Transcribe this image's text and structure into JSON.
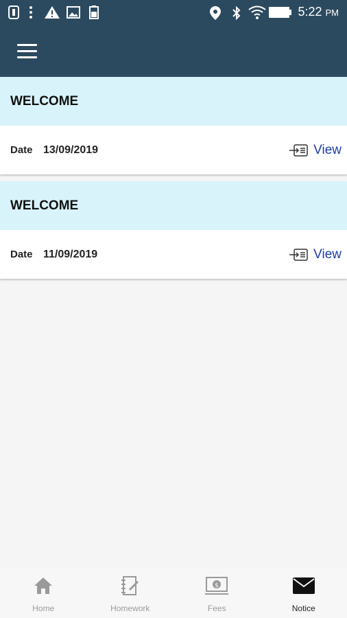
{
  "status_bar": {
    "time": "5:22",
    "ampm": "PM",
    "icons": [
      "sim-icon",
      "more-dots-icon",
      "warning-icon",
      "image-icon",
      "battery-saver-icon",
      "location-icon",
      "bluetooth-icon",
      "wifi-icon",
      "battery-icon"
    ]
  },
  "app_bar": {
    "menu_icon": "hamburger-menu-icon"
  },
  "notices": [
    {
      "title": "WELCOME",
      "date_label": "Date",
      "date": "13/09/2019",
      "view_label": "View"
    },
    {
      "title": "WELCOME",
      "date_label": "Date",
      "date": "11/09/2019",
      "view_label": "View"
    }
  ],
  "bottom_nav": {
    "items": [
      {
        "label": "Home",
        "icon": "home-icon",
        "active": false
      },
      {
        "label": "Homework",
        "icon": "homework-icon",
        "active": false
      },
      {
        "label": "Fees",
        "icon": "fees-icon",
        "active": false
      },
      {
        "label": "Notice",
        "icon": "mail-icon",
        "active": true
      }
    ]
  },
  "colors": {
    "app_bar": "#2c4a5f",
    "title_row": "#d8f3f9",
    "link": "#1e3ea8"
  }
}
